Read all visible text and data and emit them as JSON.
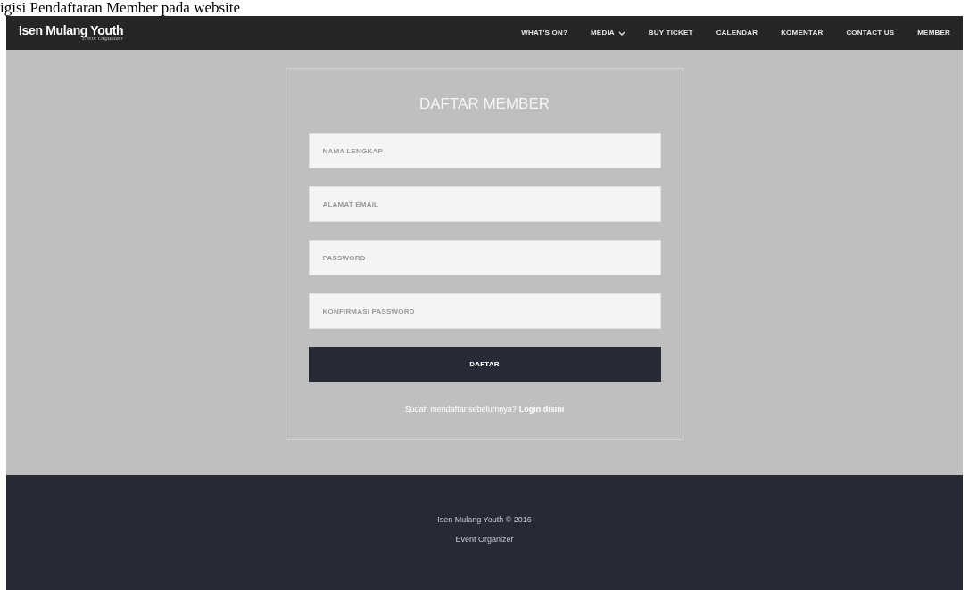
{
  "caption": "igisi Pendaftaran Member pada website",
  "brand": {
    "title": "Isen Mulang Youth",
    "subtitle": "Event Organizer"
  },
  "nav": [
    {
      "label": "WHAT'S ON?",
      "dropdown": false
    },
    {
      "label": "MEDIA",
      "dropdown": true
    },
    {
      "label": "BUY TICKET",
      "dropdown": false
    },
    {
      "label": "CALENDAR",
      "dropdown": false
    },
    {
      "label": "KOMENTAR",
      "dropdown": false
    },
    {
      "label": "CONTACT US",
      "dropdown": false
    },
    {
      "label": "MEMBER",
      "dropdown": false
    }
  ],
  "form": {
    "title": "DAFTAR MEMBER",
    "fields": [
      {
        "placeholder": "NAMA LENGKAP"
      },
      {
        "placeholder": "ALAMAT EMAIL"
      },
      {
        "placeholder": "PASSWORD"
      },
      {
        "placeholder": "KONFIRMASI PASSWORD"
      }
    ],
    "submit": "DAFTAR",
    "login_prompt": "Sudah mendaftar sebelumnya?",
    "login_link": "Login disini"
  },
  "footer": {
    "lines": [
      "Isen Mulang Youth © 2016",
      "Event Organizer"
    ]
  }
}
